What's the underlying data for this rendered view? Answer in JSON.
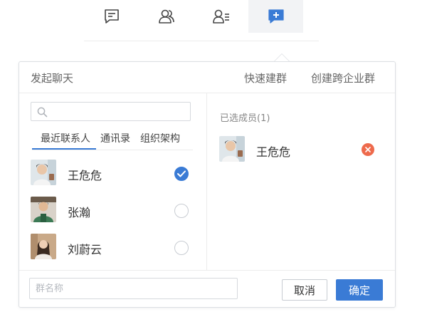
{
  "top_nav": {
    "tabs": [
      {
        "icon": "message-icon",
        "active": false
      },
      {
        "icon": "contacts-icon",
        "active": false
      },
      {
        "icon": "user-list-icon",
        "active": false
      },
      {
        "icon": "add-chat-icon",
        "active": true
      }
    ],
    "accent_color": "#3a7bd5"
  },
  "dialog": {
    "title": "发起聊天",
    "quick_group": "快速建群",
    "cross_enterprise_group": "创建跨企业群"
  },
  "search": {
    "placeholder": ""
  },
  "subtabs": {
    "recent": "最近联系人",
    "contacts": "通讯录",
    "org": "组织架构"
  },
  "contacts": [
    {
      "name": "王危危",
      "checked": true
    },
    {
      "name": "张瀚",
      "checked": false
    },
    {
      "name": "刘蔚云",
      "checked": false
    }
  ],
  "selected": {
    "label": "已选成员(1)",
    "members": [
      {
        "name": "王危危"
      }
    ]
  },
  "footer": {
    "group_name_placeholder": "群名称",
    "cancel": "取消",
    "confirm": "确定"
  },
  "colors": {
    "primary": "#3a7bd5",
    "remove": "#ee6a4c"
  }
}
